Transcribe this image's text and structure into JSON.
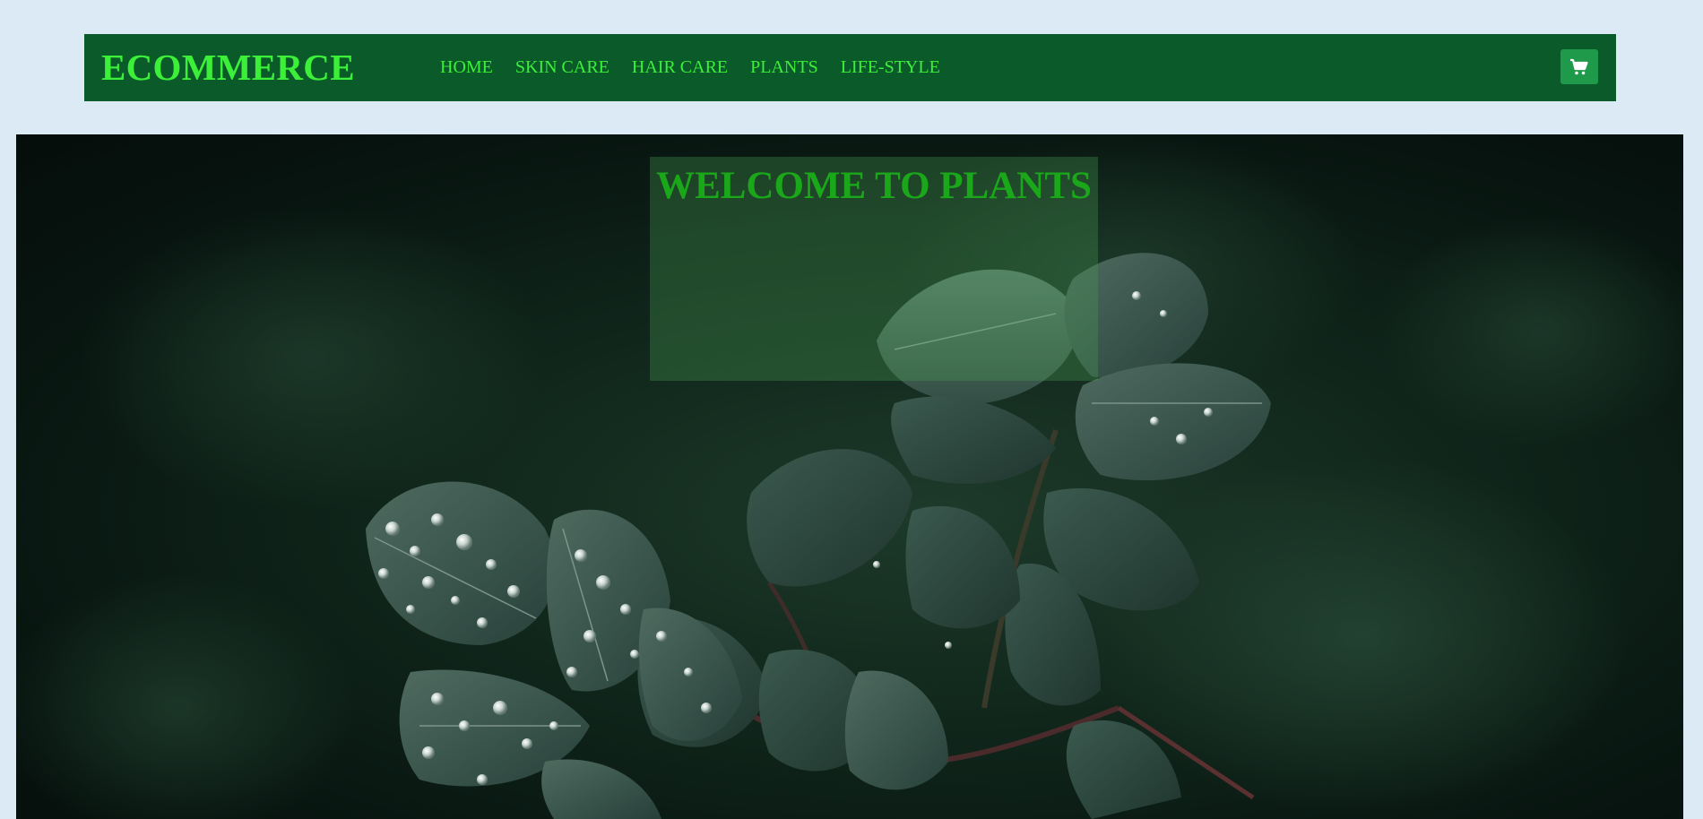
{
  "navbar": {
    "brand": "ECOMMERCE",
    "links": [
      "HOME",
      "SKIN CARE",
      "HAIR CARE",
      "PLANTS",
      "LIFE-STYLE"
    ],
    "cart_icon": "shopping-cart-icon"
  },
  "hero": {
    "title": "WELCOME TO PLANTS",
    "background": "dark green leaves with water droplets"
  },
  "colors": {
    "page_bg": "#dbeaf5",
    "navbar_bg": "#0a5a2a",
    "nav_text": "#3cf03a",
    "cart_button": "#1e9a4a",
    "hero_title": "#1aa81a"
  }
}
